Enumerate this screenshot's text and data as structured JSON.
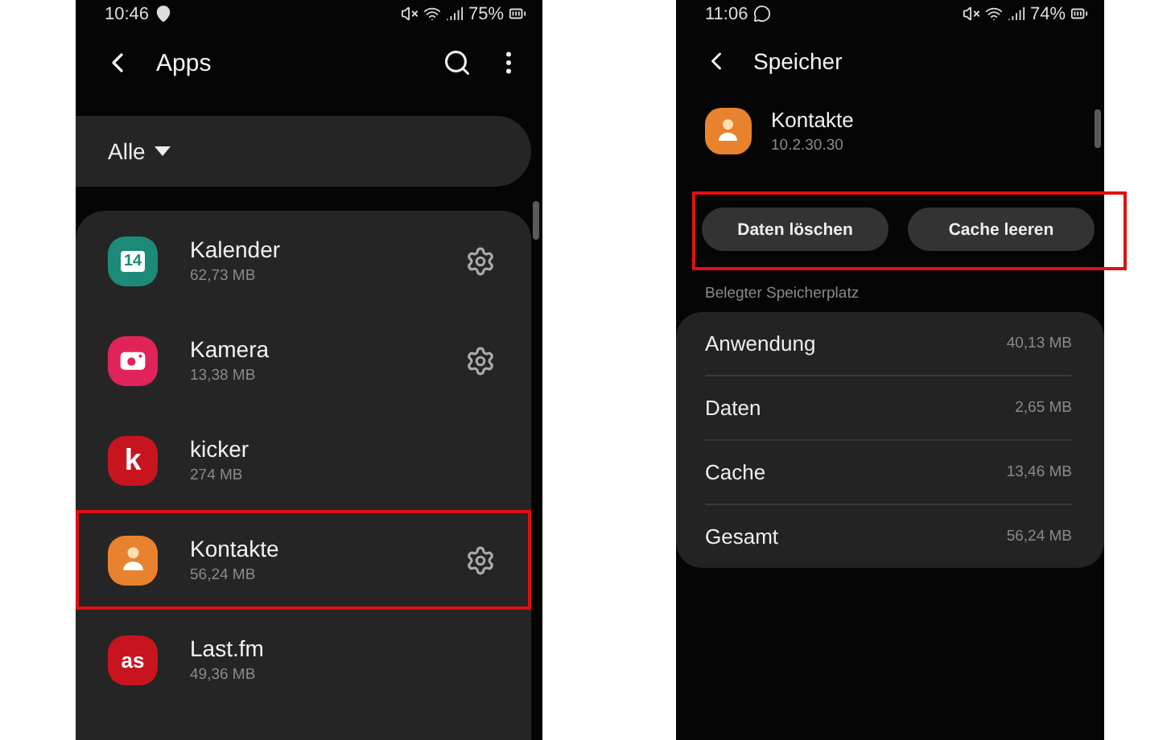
{
  "apps_screen": {
    "status_bar": {
      "time": "10:46",
      "battery": "75%"
    },
    "title": "Apps",
    "filter": {
      "label": "Alle"
    },
    "apps": [
      {
        "name": "Kalender",
        "size": "62,73 MB",
        "kind": "calendar",
        "icon_text": "14",
        "color": "#1b8a78",
        "has_settings": true,
        "highlighted": false
      },
      {
        "name": "Kamera",
        "size": "13,38 MB",
        "kind": "camera",
        "color": "#e0245a",
        "has_settings": true,
        "highlighted": false
      },
      {
        "name": "kicker",
        "size": "274 MB",
        "kind": "letter",
        "icon_text": "k",
        "color": "#c8141e",
        "has_settings": false,
        "highlighted": false
      },
      {
        "name": "Kontakte",
        "size": "56,24 MB",
        "kind": "contact",
        "color": "#e9822e",
        "has_settings": true,
        "highlighted": true
      },
      {
        "name": "Last.fm",
        "size": "49,36 MB",
        "kind": "letter",
        "icon_text": "as",
        "color": "#c8141e",
        "has_settings": false,
        "highlighted": false
      }
    ]
  },
  "storage_screen": {
    "status_bar": {
      "time": "11:06",
      "battery": "74%"
    },
    "title": "Speicher",
    "app": {
      "name": "Kontakte",
      "version": "10.2.30.30",
      "kind": "contact",
      "color": "#e9822e"
    },
    "actions": {
      "highlighted": true,
      "buttons": [
        "Daten löschen",
        "Cache leeren"
      ]
    },
    "section_label": "Belegter Speicherplatz",
    "usage": [
      {
        "label": "Anwendung",
        "value": "40,13 MB"
      },
      {
        "label": "Daten",
        "value": "2,65 MB"
      },
      {
        "label": "Cache",
        "value": "13,46 MB"
      },
      {
        "label": "Gesamt",
        "value": "56,24 MB"
      }
    ]
  }
}
